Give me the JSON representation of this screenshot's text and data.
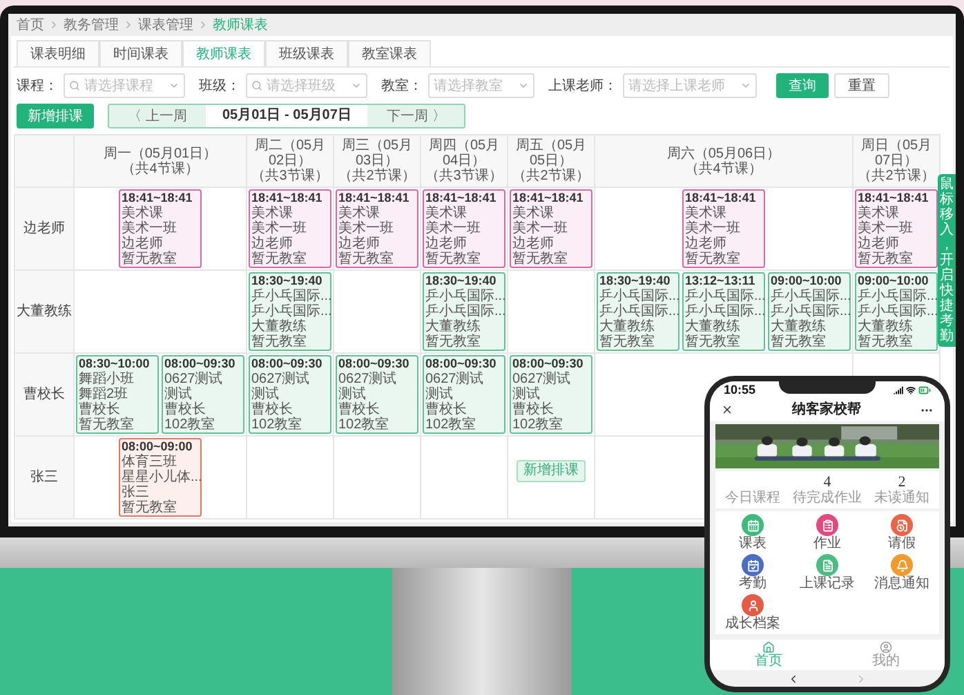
{
  "breadcrumb": [
    {
      "label": "首页",
      "current": false
    },
    {
      "label": "教务管理",
      "current": false
    },
    {
      "label": "课表管理",
      "current": false
    },
    {
      "label": "教师课表",
      "current": true
    }
  ],
  "tabs": [
    {
      "label": "课表明细",
      "selected": false
    },
    {
      "label": "时间课表",
      "selected": false
    },
    {
      "label": "教师课表",
      "selected": true
    },
    {
      "label": "班级课表",
      "selected": false
    },
    {
      "label": "教室课表",
      "selected": false
    }
  ],
  "filters": [
    {
      "label": "课程：",
      "placeholder": "请选择课程",
      "searchable": true
    },
    {
      "label": "班级：",
      "placeholder": "请选择班级",
      "searchable": true
    },
    {
      "label": "教室：",
      "placeholder": "请选择教室",
      "searchable": false
    },
    {
      "label": "上课老师：",
      "placeholder": "请选择上课老师",
      "searchable": false
    }
  ],
  "filter_buttons": [
    {
      "label": "查询",
      "kind": "primary"
    },
    {
      "label": "重置",
      "kind": "default"
    }
  ],
  "add_button": "新增排课",
  "week_nav": {
    "prev": "〈 上一周",
    "range": "05月01日 - 05月07日",
    "next": "下一周 〉"
  },
  "quick_tab": "鼠标移入，开启快捷考勤",
  "schedule": {
    "days": [
      {
        "title": "周一（05月01日）",
        "count": "（共4节课）"
      },
      {
        "title": "周二（05月02日）",
        "count": "（共3节课）"
      },
      {
        "title": "周三（05月03日）",
        "count": "（共2节课）"
      },
      {
        "title": "周四（05月04日）",
        "count": "（共3节课）"
      },
      {
        "title": "周五（05月05日）",
        "count": "（共2节课）"
      },
      {
        "title": "周六（05月06日）",
        "count": "（共4节课）"
      },
      {
        "title": "周日（05月07日）",
        "count": "（共2节课）"
      }
    ],
    "rows": [
      {
        "teacher": "边老师",
        "cells": [
          [
            {
              "kind": "card",
              "color": "#d66aa6",
              "time": "18:41~18:41",
              "lines": [
                "美术课",
                "美术一班",
                "边老师",
                "暂无教室"
              ]
            }
          ],
          [
            {
              "kind": "card",
              "color": "#d66aa6",
              "time": "18:41~18:41",
              "lines": [
                "美术课",
                "美术一班",
                "边老师",
                "暂无教室"
              ]
            }
          ],
          [
            {
              "kind": "card",
              "color": "#d66aa6",
              "time": "18:41~18:41",
              "lines": [
                "美术课",
                "美术一班",
                "边老师",
                "暂无教室"
              ]
            }
          ],
          [
            {
              "kind": "card",
              "color": "#d66aa6",
              "time": "18:41~18:41",
              "lines": [
                "美术课",
                "美术一班",
                "边老师",
                "暂无教室"
              ]
            }
          ],
          [
            {
              "kind": "card",
              "color": "#d66aa6",
              "time": "18:41~18:41",
              "lines": [
                "美术课",
                "美术一班",
                "边老师",
                "暂无教室"
              ]
            }
          ],
          [
            {
              "kind": "card",
              "color": "#d66aa6",
              "time": "18:41~18:41",
              "lines": [
                "美术课",
                "美术一班",
                "边老师",
                "暂无教室"
              ]
            }
          ],
          [
            {
              "kind": "card",
              "color": "#d66aa6",
              "time": "18:41~18:41",
              "lines": [
                "美术课",
                "美术一班",
                "边老师",
                "暂无教室"
              ]
            }
          ]
        ]
      },
      {
        "teacher": "大董教练",
        "cells": [
          [],
          [
            {
              "kind": "card",
              "color": "#5cc497",
              "time": "18:30~19:40",
              "lines": [
                "乒小乓国际...",
                "乒小乓国际...",
                "大董教练",
                "暂无教室"
              ]
            }
          ],
          [],
          [
            {
              "kind": "card",
              "color": "#5cc497",
              "time": "18:30~19:40",
              "lines": [
                "乒小乓国际...",
                "乒小乓国际...",
                "大董教练",
                "暂无教室"
              ]
            }
          ],
          [],
          [
            {
              "kind": "card",
              "color": "#5cc497",
              "time": "18:30~19:40",
              "lines": [
                "乒小乓国际...",
                "乒小乓国际...",
                "大董教练",
                "暂无教室"
              ]
            },
            {
              "kind": "card",
              "color": "#5cc497",
              "time": "13:12~13:11",
              "lines": [
                "乒小乓国际...",
                "乒小乓国际...",
                "大董教练",
                "暂无教室"
              ]
            },
            {
              "kind": "card",
              "color": "#5cc497",
              "time": "09:00~10:00",
              "lines": [
                "乒小乓国际...",
                "乒小乓国际...",
                "大董教练",
                "暂无教室"
              ]
            }
          ],
          [
            {
              "kind": "card",
              "color": "#5cc497",
              "time": "09:00~10:00",
              "lines": [
                "乒小乓国际...",
                "乒小乓国际...",
                "大董教练",
                "暂无教室"
              ]
            }
          ]
        ]
      },
      {
        "teacher": "曹校长",
        "cells": [
          [
            {
              "kind": "card",
              "color": "#5cc497",
              "time": "08:30~10:00",
              "lines": [
                "舞蹈小班",
                "舞蹈2班",
                "曹校长",
                "暂无教室"
              ]
            },
            {
              "kind": "card",
              "color": "#5cc497",
              "time": "08:00~09:30",
              "lines": [
                "0627测试",
                "测试",
                "曹校长",
                "102教室"
              ]
            }
          ],
          [
            {
              "kind": "card",
              "color": "#5cc497",
              "time": "08:00~09:30",
              "lines": [
                "0627测试",
                "测试",
                "曹校长",
                "102教室"
              ]
            }
          ],
          [
            {
              "kind": "card",
              "color": "#5cc497",
              "time": "08:00~09:30",
              "lines": [
                "0627测试",
                "测试",
                "曹校长",
                "102教室"
              ]
            }
          ],
          [
            {
              "kind": "card",
              "color": "#5cc497",
              "time": "08:00~09:30",
              "lines": [
                "0627测试",
                "测试",
                "曹校长",
                "102教室"
              ]
            }
          ],
          [
            {
              "kind": "card",
              "color": "#5cc497",
              "time": "08:00~09:30",
              "lines": [
                "0627测试",
                "测试",
                "曹校长",
                "102教室"
              ]
            }
          ],
          [],
          []
        ]
      },
      {
        "teacher": "张三",
        "cells": [
          [
            {
              "kind": "card",
              "color": "#e27763",
              "time": "08:00~09:00",
              "lines": [
                "体育三班",
                "星星小儿体...",
                "张三",
                "暂无教室"
              ]
            }
          ],
          [],
          [],
          [],
          [
            {
              "kind": "add",
              "label": "新增排课"
            }
          ],
          [],
          []
        ]
      }
    ]
  },
  "phone": {
    "time": "10:55",
    "title": "纳客家校帮",
    "stats": [
      {
        "label": "今日课程"
      },
      {
        "value": "4",
        "label": "待完成作业"
      },
      {
        "value": "2",
        "label": "未读通知"
      }
    ],
    "menu": [
      {
        "label": "课表",
        "color": "#3dba7c"
      },
      {
        "label": "作业",
        "color": "#e2497f"
      },
      {
        "label": "请假",
        "color": "#ec6448"
      },
      {
        "label": "考勤",
        "color": "#4a6ec2"
      },
      {
        "label": "上课记录",
        "color": "#4cbc84"
      },
      {
        "label": "消息通知",
        "color": "#f39a2c"
      },
      {
        "label": "成长档案",
        "color": "#e45a44"
      }
    ],
    "tabbar": [
      {
        "label": "首页",
        "selected": true
      },
      {
        "label": "我的",
        "selected": false
      }
    ],
    "nav": {
      "back_disabled": false,
      "forward_disabled": true
    }
  }
}
